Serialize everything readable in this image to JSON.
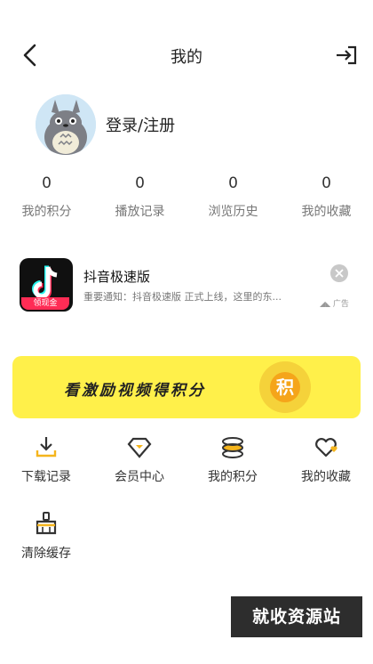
{
  "header": {
    "title": "我的",
    "back_icon": "chevron-left-icon",
    "logout_icon": "logout-icon"
  },
  "profile": {
    "avatar": "totoro-avatar",
    "login_label": "登录/注册"
  },
  "stats": [
    {
      "value": "0",
      "label": "我的积分"
    },
    {
      "value": "0",
      "label": "播放记录"
    },
    {
      "value": "0",
      "label": "浏览历史"
    },
    {
      "value": "0",
      "label": "我的收藏"
    }
  ],
  "ad": {
    "app_name": "抖音极速版",
    "description": "重要通知：抖音极速版 正式上线，这里的东...",
    "badge": "领现金",
    "tag": "广告"
  },
  "banner": {
    "text": "看激励视频得积分",
    "coin_label": "积",
    "bg_color": "#fff04a"
  },
  "grid": [
    {
      "label": "下载记录",
      "icon": "download-icon"
    },
    {
      "label": "会员中心",
      "icon": "diamond-icon"
    },
    {
      "label": "我的积分",
      "icon": "coins-icon"
    },
    {
      "label": "我的收藏",
      "icon": "heart-icon"
    },
    {
      "label": "清除缓存",
      "icon": "broom-icon"
    }
  ],
  "watermark": "就收资源站"
}
